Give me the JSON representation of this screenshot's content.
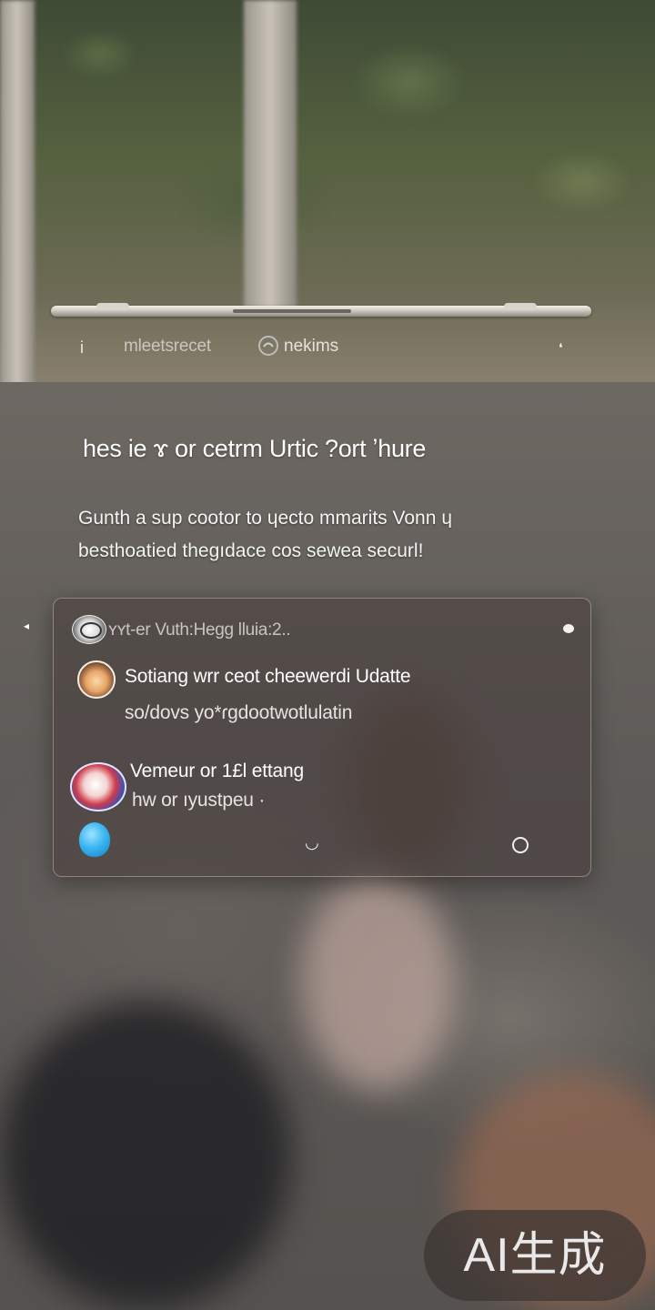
{
  "header": {
    "menu_glyph": "i",
    "title": "mleetsrecet",
    "title2": "nekims",
    "more_glyph": "❛"
  },
  "headline": "hes ie ɤ or cetrm Urtic ?ort ʼhure",
  "paragraph": {
    "line1": "Gunth a sup cootor to ɥecto mmarits Vonn ɥ",
    "line2": "besthoatied thegıdace cos sewea securl!"
  },
  "card": {
    "side_arrow": "◂",
    "sender": "ʏʏt-er Vuth:Hegg lluia:2..",
    "items": [
      {
        "line1": "Sotiang wrr ceot cheewerdi Udatte",
        "line2": "so/dovs yo*ɾgdootwotlulatin"
      },
      {
        "line1": "Vemeur or 1£l ettang",
        "line2": "hw or ıyustpeu ·"
      }
    ],
    "footer_mid_glyph": "◡",
    "icons": [
      "sun-icon",
      "globe-icon",
      "drop-icon",
      "more-dots-icon",
      "circle-icon"
    ]
  },
  "badge": "AI生成",
  "colors": {
    "card_bg": "#463e3c",
    "card_border": "#c8b4aa",
    "text": "#ffffff"
  }
}
